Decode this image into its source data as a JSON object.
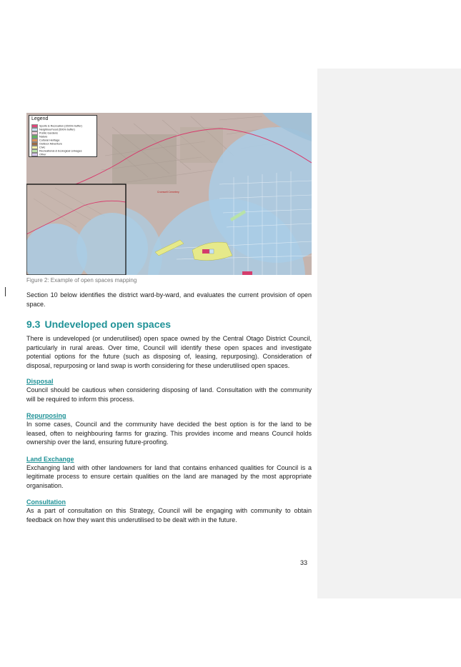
{
  "figure": {
    "caption": "Figure 2: Example of open spaces mapping",
    "legend_title": "Legend",
    "legend_items": [
      {
        "label": "Sports & Recreation (1500m buffer)",
        "color": "#e0457b"
      },
      {
        "label": "Neighbourhood (500m buffer)",
        "color": "#c9e3f5"
      },
      {
        "label": "Public Gardens",
        "color": "#f7d1e0"
      },
      {
        "label": "Nature",
        "color": "#5fb55f"
      },
      {
        "label": "Cultural Heritage",
        "color": "#d9935a"
      },
      {
        "label": "Outdoor Adventure",
        "color": "#9a6b45"
      },
      {
        "label": "Civic",
        "color": "#f3f2a6"
      },
      {
        "label": "Recreational & Ecological Linkages",
        "color": "#b9e3a8"
      },
      {
        "label": "Other",
        "color": "#d8c8ef"
      }
    ],
    "map_label": "Cromwell Cemetery",
    "colors": {
      "land": "#c5b4ae",
      "buffer": "#a9cde6",
      "route": "#d8386b",
      "civic": "#e6e98a",
      "sports": "#d43d6c"
    }
  },
  "body": {
    "para1": "Section 10 below identifies the district ward-by-ward, and evaluates the current provision of open space.",
    "heading_number": "9.3",
    "heading_text": "Undeveloped open spaces",
    "para2": "There is undeveloped (or underutilised) open space owned by the Central Otago District Council, particularly in rural areas. Over time, Council will identify these open spaces and investigate potential options for the future (such as disposing of, leasing, repurposing). Consideration of disposal, repurposing or land swap is worth considering for these underutilised open spaces.",
    "sections": [
      {
        "title": "Disposal",
        "text": "Council should be cautious when considering disposing of land. Consultation with the community will be required to inform this process."
      },
      {
        "title": "Repurposing",
        "text": "In some cases, Council and the community have decided the best option is for the land to be leased, often to neighbouring farms for grazing. This provides income and means Council holds ownership over the land, ensuring future-proofing."
      },
      {
        "title": "Land Exchange",
        "text": "Exchanging land with other landowners for land that contains enhanced qualities for Council is a legitimate process to ensure certain qualities on the land are managed by the most appropriate organisation."
      },
      {
        "title": "Consultation",
        "text": "As a part of consultation on this Strategy, Council will be engaging with community to obtain feedback on how they want this underutilised to be dealt with in the future."
      }
    ]
  },
  "page_number": "33"
}
